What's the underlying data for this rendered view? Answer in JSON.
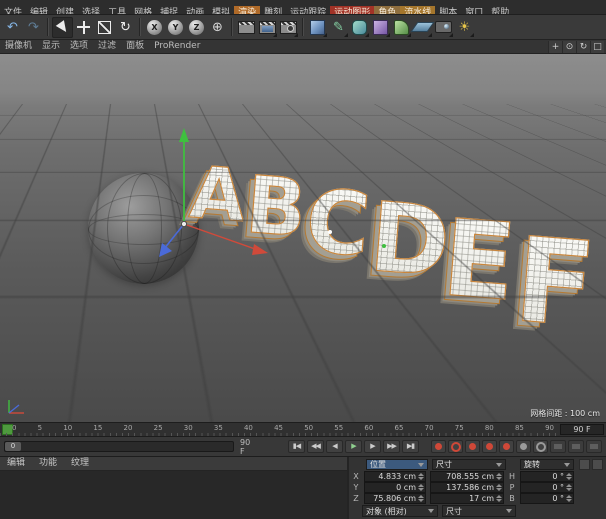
{
  "menubar": {
    "items": [
      {
        "label": "文件"
      },
      {
        "label": "编辑"
      },
      {
        "label": "创建"
      },
      {
        "label": "选择"
      },
      {
        "label": "工具"
      },
      {
        "label": "网格"
      },
      {
        "label": "捕捉"
      },
      {
        "label": "动画"
      },
      {
        "label": "模拟"
      },
      {
        "label": "渲染",
        "bg": "#b06a28"
      },
      {
        "label": "雕刻"
      },
      {
        "label": "运动跟踪"
      },
      {
        "label": "运动图形",
        "bg": "#a23226"
      },
      {
        "label": "角色",
        "bg": "#8f6e3e"
      },
      {
        "label": "流水线",
        "bg": "#a5762c"
      },
      {
        "label": "脚本"
      },
      {
        "label": "窗口"
      },
      {
        "label": "帮助"
      }
    ]
  },
  "toolbar": {
    "icons": [
      {
        "name": "undo-button",
        "glyph": "↶",
        "color": "#86b7e8"
      },
      {
        "name": "redo-button",
        "glyph": "↷",
        "color": "#5f7d96"
      },
      {
        "divider": true
      },
      {
        "name": "live-selection-tool",
        "shape": "cursor",
        "pressed": true
      },
      {
        "name": "move-tool",
        "shape": "move"
      },
      {
        "name": "scale-tool",
        "shape": "scale"
      },
      {
        "name": "rotate-tool",
        "glyph": "↻",
        "color": "#ececec"
      },
      {
        "divider": true
      },
      {
        "name": "x-axis-lock-button",
        "glyph": "X",
        "ball": true
      },
      {
        "name": "y-axis-lock-button",
        "glyph": "Y",
        "ball": true
      },
      {
        "name": "z-axis-lock-button",
        "glyph": "Z",
        "ball": true
      },
      {
        "name": "coordinate-system-button",
        "glyph": "⊕",
        "color": "#d8d8d8"
      },
      {
        "divider": true
      },
      {
        "name": "render-view-button",
        "shape": "clapper"
      },
      {
        "name": "render-picture-viewer-button",
        "shape": "clapper2",
        "tri": true
      },
      {
        "name": "render-settings-button",
        "shape": "clapper3",
        "tri": true
      },
      {
        "divider": true
      },
      {
        "name": "add-cube-button",
        "shape": "cube",
        "tri": true
      },
      {
        "name": "spline-pen-button",
        "glyph": "✎",
        "color": "#84cfa2",
        "tri": true
      },
      {
        "name": "subdivision-surface-button",
        "shape": "sds",
        "tri": true
      },
      {
        "name": "generator-button",
        "shape": "gen",
        "tri": true
      },
      {
        "name": "deformer-button",
        "shape": "bend",
        "tri": true
      },
      {
        "name": "environment-button",
        "shape": "floor",
        "tri": true
      },
      {
        "name": "camera-button",
        "shape": "camera",
        "tri": true
      },
      {
        "name": "light-button",
        "glyph": "☀",
        "color": "#e6c54a",
        "tri": true
      }
    ]
  },
  "viewport": {
    "menu": [
      {
        "label": "摄像机"
      },
      {
        "label": "显示"
      },
      {
        "label": "选项"
      },
      {
        "label": "过滤"
      },
      {
        "label": "面板"
      },
      {
        "label": "ProRender"
      }
    ],
    "view_controls": [
      {
        "name": "pan-view-button",
        "glyph": "+"
      },
      {
        "name": "zoom-view-button",
        "glyph": "⊙"
      },
      {
        "name": "rotate-view-button",
        "glyph": "↻"
      },
      {
        "name": "toggle-layout-button",
        "glyph": "□"
      }
    ],
    "grid_label": "网格间距 : 100 cm",
    "letters": [
      "A",
      "B",
      "C",
      "D",
      "E",
      "F"
    ]
  },
  "timeline": {
    "ticks": [
      "0",
      "5",
      "10",
      "15",
      "20",
      "25",
      "30",
      "35",
      "40",
      "45",
      "50",
      "55",
      "60",
      "65",
      "70",
      "75",
      "80",
      "85",
      "90"
    ],
    "end_frame": "90 F"
  },
  "transport": {
    "range_start": "0",
    "range_end": "90 F",
    "buttons": [
      {
        "name": "go-to-start-button",
        "glyph": "▮◀"
      },
      {
        "name": "previous-key-button",
        "glyph": "◀◀"
      },
      {
        "name": "previous-frame-button",
        "glyph": "◀"
      },
      {
        "name": "play-button",
        "glyph": "▶",
        "color": "#8fcf8f"
      },
      {
        "name": "next-frame-button",
        "glyph": "▶"
      },
      {
        "name": "next-key-button",
        "glyph": "▶▶"
      },
      {
        "name": "go-to-end-button",
        "glyph": "▶▮"
      }
    ],
    "record_buttons": [
      {
        "name": "record-keyframe-button",
        "kind": "dot",
        "color": "#cf4838"
      },
      {
        "name": "autokey-button",
        "kind": "ring",
        "color": "#cf4838"
      },
      {
        "name": "record-position-button",
        "kind": "dot",
        "color": "#cf4838"
      },
      {
        "name": "record-scale-button",
        "kind": "dot",
        "color": "#cf4838"
      },
      {
        "name": "record-rotation-button",
        "kind": "dot",
        "color": "#cf4838"
      },
      {
        "name": "record-parameter-button",
        "kind": "dot",
        "color": "#9a9a9a"
      },
      {
        "name": "record-point-level-button",
        "kind": "ring",
        "color": "#9a9a9a"
      }
    ],
    "extra_buttons": [
      {
        "name": "keyframe-selection-button"
      },
      {
        "name": "timeline-options-button"
      },
      {
        "name": "hud-toggle-button"
      }
    ]
  },
  "materials_panel": {
    "tabs": [
      {
        "label": "编辑"
      },
      {
        "label": "功能"
      },
      {
        "label": "纹理"
      }
    ]
  },
  "coordinates_panel": {
    "headers": [
      {
        "label": "位置"
      },
      {
        "label": "尺寸"
      },
      {
        "label": "旋转"
      }
    ],
    "rows": [
      {
        "pos_label": "X",
        "pos": "4.833 cm",
        "size": "708.555 cm",
        "rot_label": "H",
        "rot": "0 °"
      },
      {
        "pos_label": "Y",
        "pos": "0 cm",
        "size": "137.586 cm",
        "rot_label": "P",
        "rot": "0 °"
      },
      {
        "pos_label": "Z",
        "pos": "75.806 cm",
        "size": "17 cm",
        "rot_label": "B",
        "rot": "0 °"
      }
    ],
    "mode_dropdown": "对象 (相对)",
    "size_dropdown": "尺寸"
  }
}
